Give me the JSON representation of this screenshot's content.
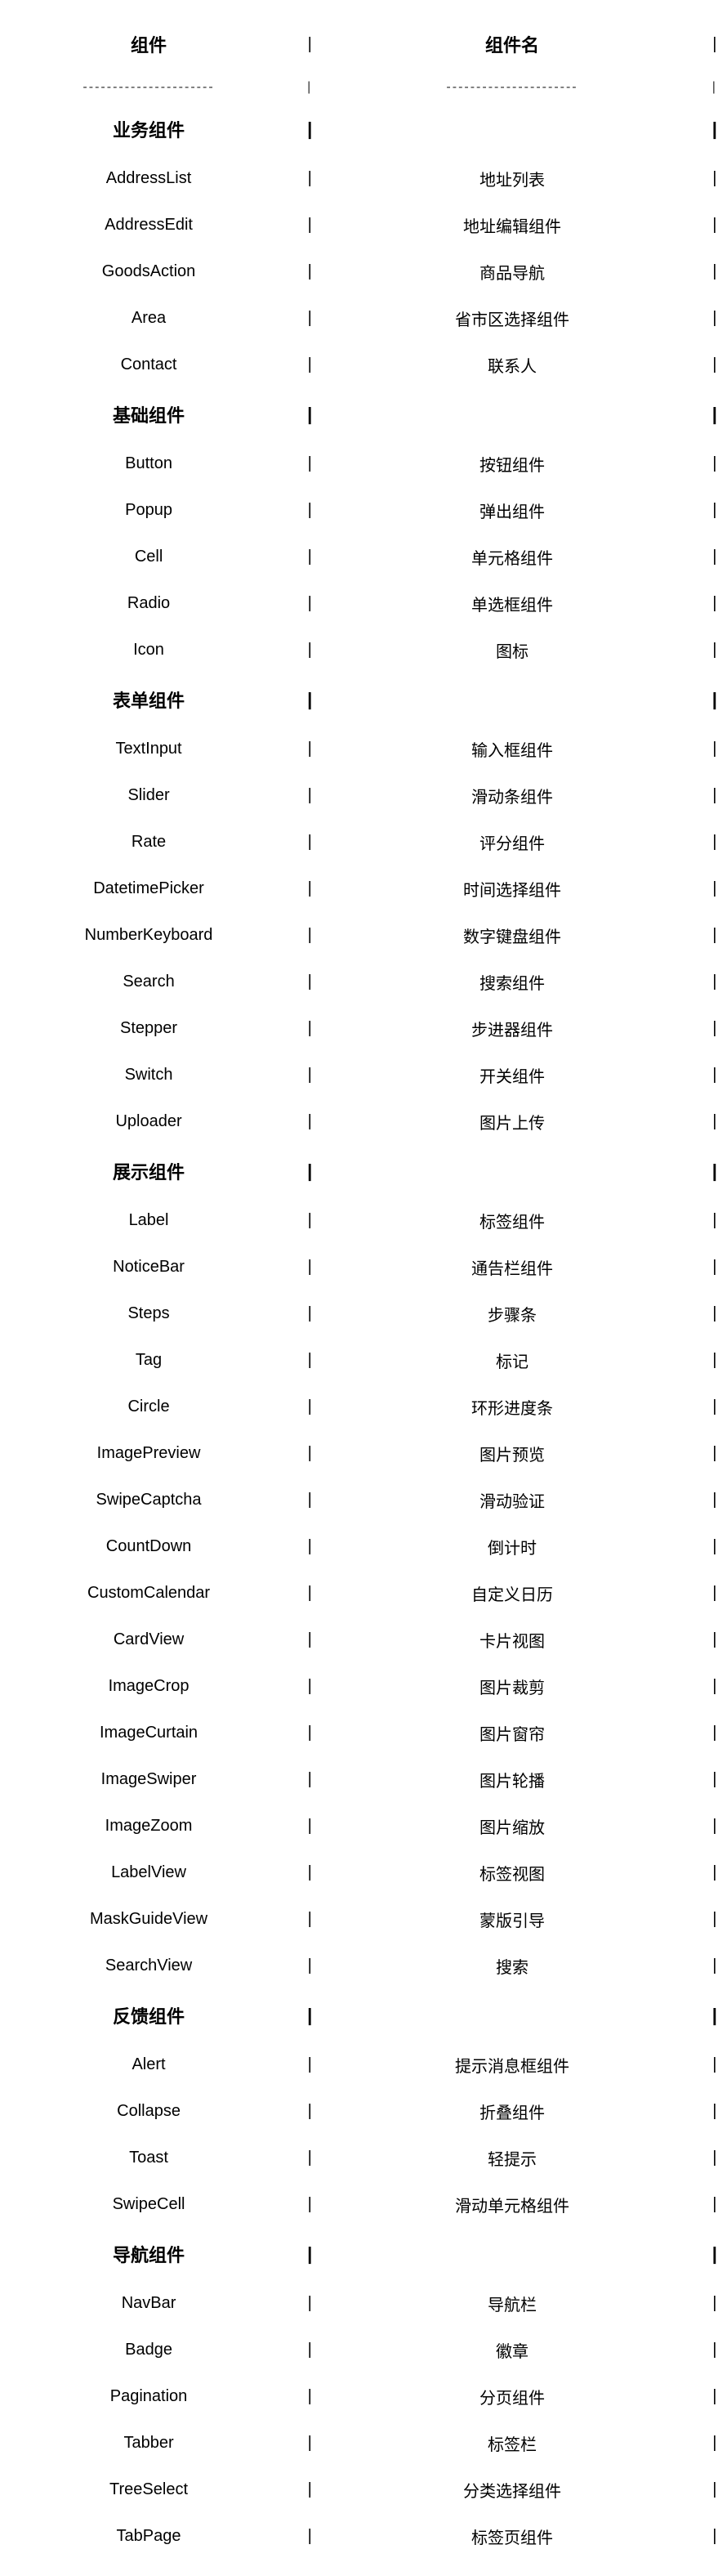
{
  "header": {
    "col1": "组件",
    "col2": "组件名"
  },
  "separator": "----------------------",
  "rows": [
    {
      "type": "category",
      "col1": "业务组件",
      "col2": ""
    },
    {
      "type": "item",
      "col1": "AddressList",
      "col2": "地址列表"
    },
    {
      "type": "item",
      "col1": "AddressEdit",
      "col2": "地址编辑组件"
    },
    {
      "type": "item",
      "col1": "GoodsAction",
      "col2": "商品导航"
    },
    {
      "type": "item",
      "col1": "Area",
      "col2": "省市区选择组件"
    },
    {
      "type": "item",
      "col1": "Contact",
      "col2": "联系人"
    },
    {
      "type": "category",
      "col1": "基础组件",
      "col2": ""
    },
    {
      "type": "item",
      "col1": "Button",
      "col2": "按钮组件"
    },
    {
      "type": "item",
      "col1": "Popup",
      "col2": "弹出组件"
    },
    {
      "type": "item",
      "col1": "Cell",
      "col2": "单元格组件"
    },
    {
      "type": "item",
      "col1": "Radio",
      "col2": "单选框组件"
    },
    {
      "type": "item",
      "col1": "Icon",
      "col2": "图标"
    },
    {
      "type": "category",
      "col1": "表单组件",
      "col2": ""
    },
    {
      "type": "item",
      "col1": "TextInput",
      "col2": "输入框组件"
    },
    {
      "type": "item",
      "col1": "Slider",
      "col2": "滑动条组件"
    },
    {
      "type": "item",
      "col1": "Rate",
      "col2": "评分组件"
    },
    {
      "type": "item",
      "col1": "DatetimePicker",
      "col2": "时间选择组件"
    },
    {
      "type": "item",
      "col1": "NumberKeyboard",
      "col2": "数字键盘组件"
    },
    {
      "type": "item",
      "col1": "Search",
      "col2": "搜索组件"
    },
    {
      "type": "item",
      "col1": "Stepper",
      "col2": "步进器组件"
    },
    {
      "type": "item",
      "col1": "Switch",
      "col2": "开关组件"
    },
    {
      "type": "item",
      "col1": "Uploader",
      "col2": "图片上传"
    },
    {
      "type": "category",
      "col1": "展示组件",
      "col2": ""
    },
    {
      "type": "item",
      "col1": "Label",
      "col2": "标签组件"
    },
    {
      "type": "item",
      "col1": "NoticeBar",
      "col2": "通告栏组件"
    },
    {
      "type": "item",
      "col1": "Steps",
      "col2": "步骤条"
    },
    {
      "type": "item",
      "col1": "Tag",
      "col2": "标记"
    },
    {
      "type": "item",
      "col1": "Circle",
      "col2": "环形进度条"
    },
    {
      "type": "item",
      "col1": "ImagePreview",
      "col2": "图片预览"
    },
    {
      "type": "item",
      "col1": "SwipeCaptcha",
      "col2": "滑动验证"
    },
    {
      "type": "item",
      "col1": "CountDown",
      "col2": "倒计时"
    },
    {
      "type": "item",
      "col1": "CustomCalendar",
      "col2": "自定义日历"
    },
    {
      "type": "item",
      "col1": "CardView",
      "col2": "卡片视图"
    },
    {
      "type": "item",
      "col1": "ImageCrop",
      "col2": "图片裁剪"
    },
    {
      "type": "item",
      "col1": "ImageCurtain",
      "col2": "图片窗帘"
    },
    {
      "type": "item",
      "col1": "ImageSwiper",
      "col2": "图片轮播"
    },
    {
      "type": "item",
      "col1": "ImageZoom",
      "col2": "图片缩放"
    },
    {
      "type": "item",
      "col1": "LabelView",
      "col2": "标签视图"
    },
    {
      "type": "item",
      "col1": "MaskGuideView",
      "col2": "蒙版引导"
    },
    {
      "type": "item",
      "col1": "SearchView",
      "col2": "搜索"
    },
    {
      "type": "category",
      "col1": "反馈组件",
      "col2": ""
    },
    {
      "type": "item",
      "col1": "Alert",
      "col2": "提示消息框组件"
    },
    {
      "type": "item",
      "col1": "Collapse",
      "col2": "折叠组件"
    },
    {
      "type": "item",
      "col1": "Toast",
      "col2": "轻提示"
    },
    {
      "type": "item",
      "col1": "SwipeCell",
      "col2": "滑动单元格组件"
    },
    {
      "type": "category",
      "col1": "导航组件",
      "col2": ""
    },
    {
      "type": "item",
      "col1": "NavBar",
      "col2": "导航栏"
    },
    {
      "type": "item",
      "col1": "Badge",
      "col2": "徽章"
    },
    {
      "type": "item",
      "col1": "Pagination",
      "col2": "分页组件"
    },
    {
      "type": "item",
      "col1": "Tabber",
      "col2": "标签栏"
    },
    {
      "type": "item",
      "col1": "TreeSelect",
      "col2": "分类选择组件"
    },
    {
      "type": "item",
      "col1": "TabPage",
      "col2": "标签页组件"
    }
  ]
}
